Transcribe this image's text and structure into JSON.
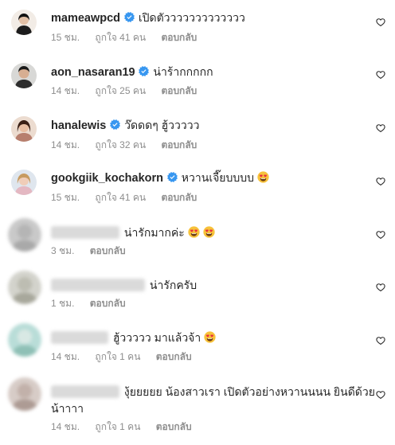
{
  "comments": [
    {
      "username": "mameawpcd",
      "verified": true,
      "text": "เปิดตัววววววววววววว",
      "time": "15 ชม.",
      "likes": "ถูกใจ 41 คน",
      "reply": "ตอบกลับ"
    },
    {
      "username": "aon_nasaran19",
      "verified": true,
      "text": "น่าร้ากกกกก",
      "time": "14 ชม.",
      "likes": "ถูกใจ 25 คน",
      "reply": "ตอบกลับ"
    },
    {
      "username": "hanalewis",
      "verified": true,
      "text": "ว๊ดดดๆ ฮู้ววววว",
      "time": "14 ชม.",
      "likes": "ถูกใจ 32 คน",
      "reply": "ตอบกลับ"
    },
    {
      "username": "gookgiik_kochakorn",
      "verified": true,
      "text": "หวานเจี๊ยบบบบ",
      "time": "15 ชม.",
      "likes": "ถูกใจ 41 คน",
      "reply": "ตอบกลับ"
    },
    {
      "username": "",
      "verified": false,
      "text": "น่ารักมากค่ะ",
      "time": "3 ชม.",
      "likes": "",
      "reply": "ตอบกลับ"
    },
    {
      "username": "",
      "verified": false,
      "text": "น่ารักครับ",
      "time": "1 ชม.",
      "likes": "",
      "reply": "ตอบกลับ"
    },
    {
      "username": "",
      "verified": false,
      "text": "ฮู้ววววว มาแล้วจ้า",
      "time": "14 ชม.",
      "likes": "ถูกใจ 1 คน",
      "reply": "ตอบกลับ"
    },
    {
      "username": "",
      "verified": false,
      "text": "งุ้ยยยยย น้องสาวเรา เปิดตัวอย่างหวานนนน ยินดีด้วย",
      "text2": "น้าาาา",
      "time": "14 ชม.",
      "likes": "ถูกใจ 1 คน",
      "reply": "ตอบกลับ"
    }
  ],
  "icons": {
    "verified": "verified-badge-icon",
    "like": "heart-outline-icon",
    "emoji": "heart-eyes-emoji"
  },
  "colors": {
    "verified": "#3897f0",
    "meta": "#8e8e8e",
    "text": "#262626"
  }
}
